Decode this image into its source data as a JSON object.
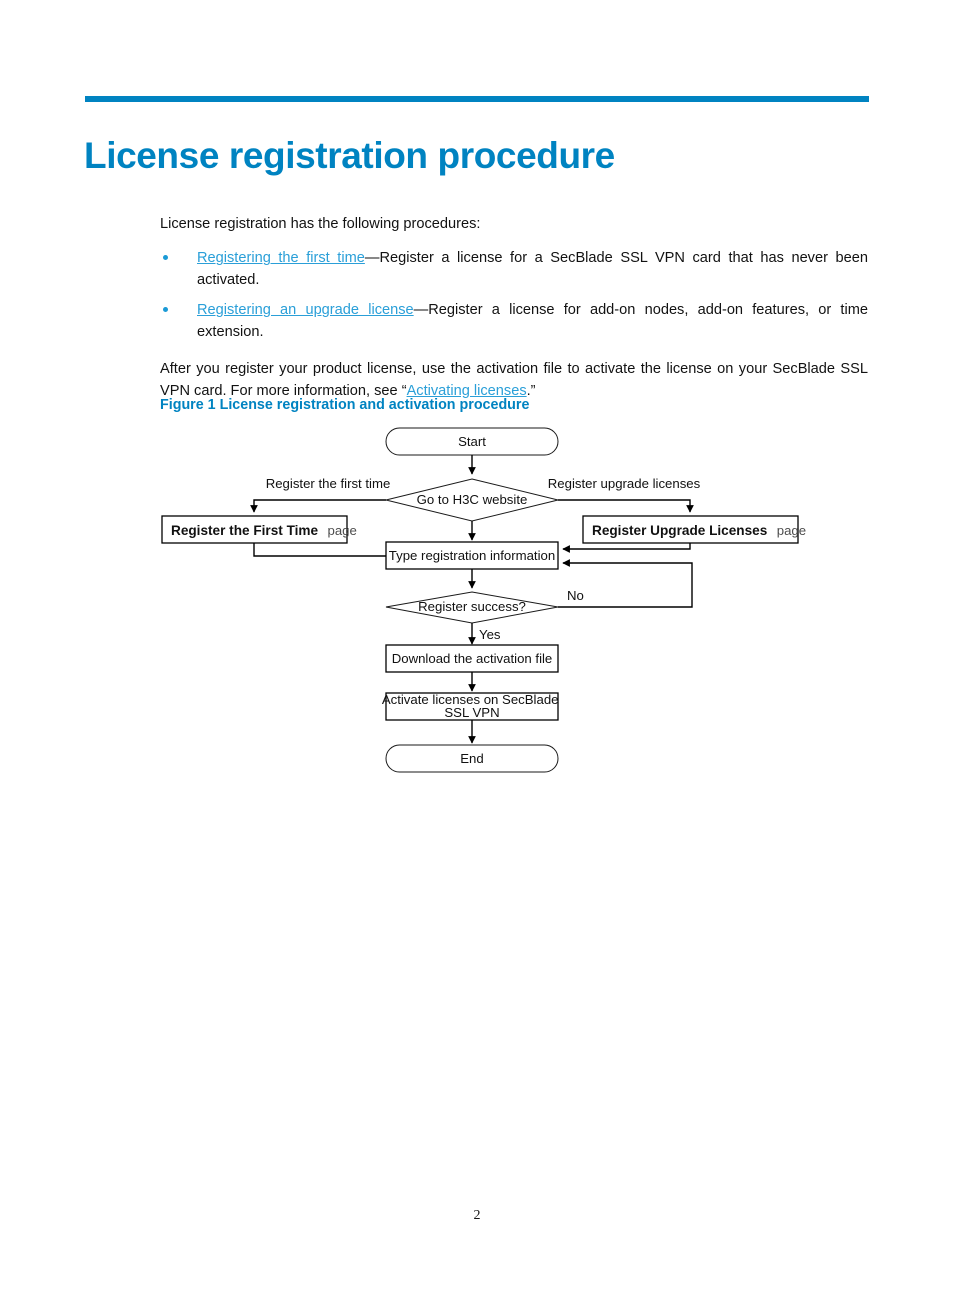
{
  "document": {
    "title": "License registration procedure",
    "page_number": "2",
    "accent_color": "#0083c1",
    "link_color": "#2a9fd8"
  },
  "body": {
    "lead": "License registration has the following procedures:",
    "bullets": [
      {
        "link": "Registering the first time",
        "separator": "—",
        "text": "Register a license for a SecBlade SSL VPN card that has never been activated."
      },
      {
        "link": "Registering an upgrade license",
        "separator": "—",
        "text": "Register a license for add-on nodes, add-on features, or time extension."
      }
    ],
    "after_paragraph": {
      "before_link": "After you register your product license, use the activation file to activate the license on your SecBlade SSL VPN card. For more information, see “",
      "link": "Activating licenses",
      "after_link": ".”"
    }
  },
  "figure": {
    "caption": "Figure 1 License registration and activation procedure",
    "nodes": {
      "start": "Start",
      "decision_website": "Go to H3C website",
      "first_time_page_bold": "Register the First Time",
      "first_time_page_suffix": "page",
      "upgrade_page_bold": "Register Upgrade Licenses",
      "upgrade_page_suffix": "page",
      "type_info": "Type registration information",
      "decision_success": "Register success?",
      "download": "Download the activation file",
      "activate_line1": "Activate licenses on SecBlade",
      "activate_line2": "SSL VPN",
      "end": "End"
    },
    "edge_labels": {
      "first_time": "Register the first time",
      "upgrade": "Register upgrade licenses",
      "no": "No",
      "yes": "Yes"
    }
  }
}
